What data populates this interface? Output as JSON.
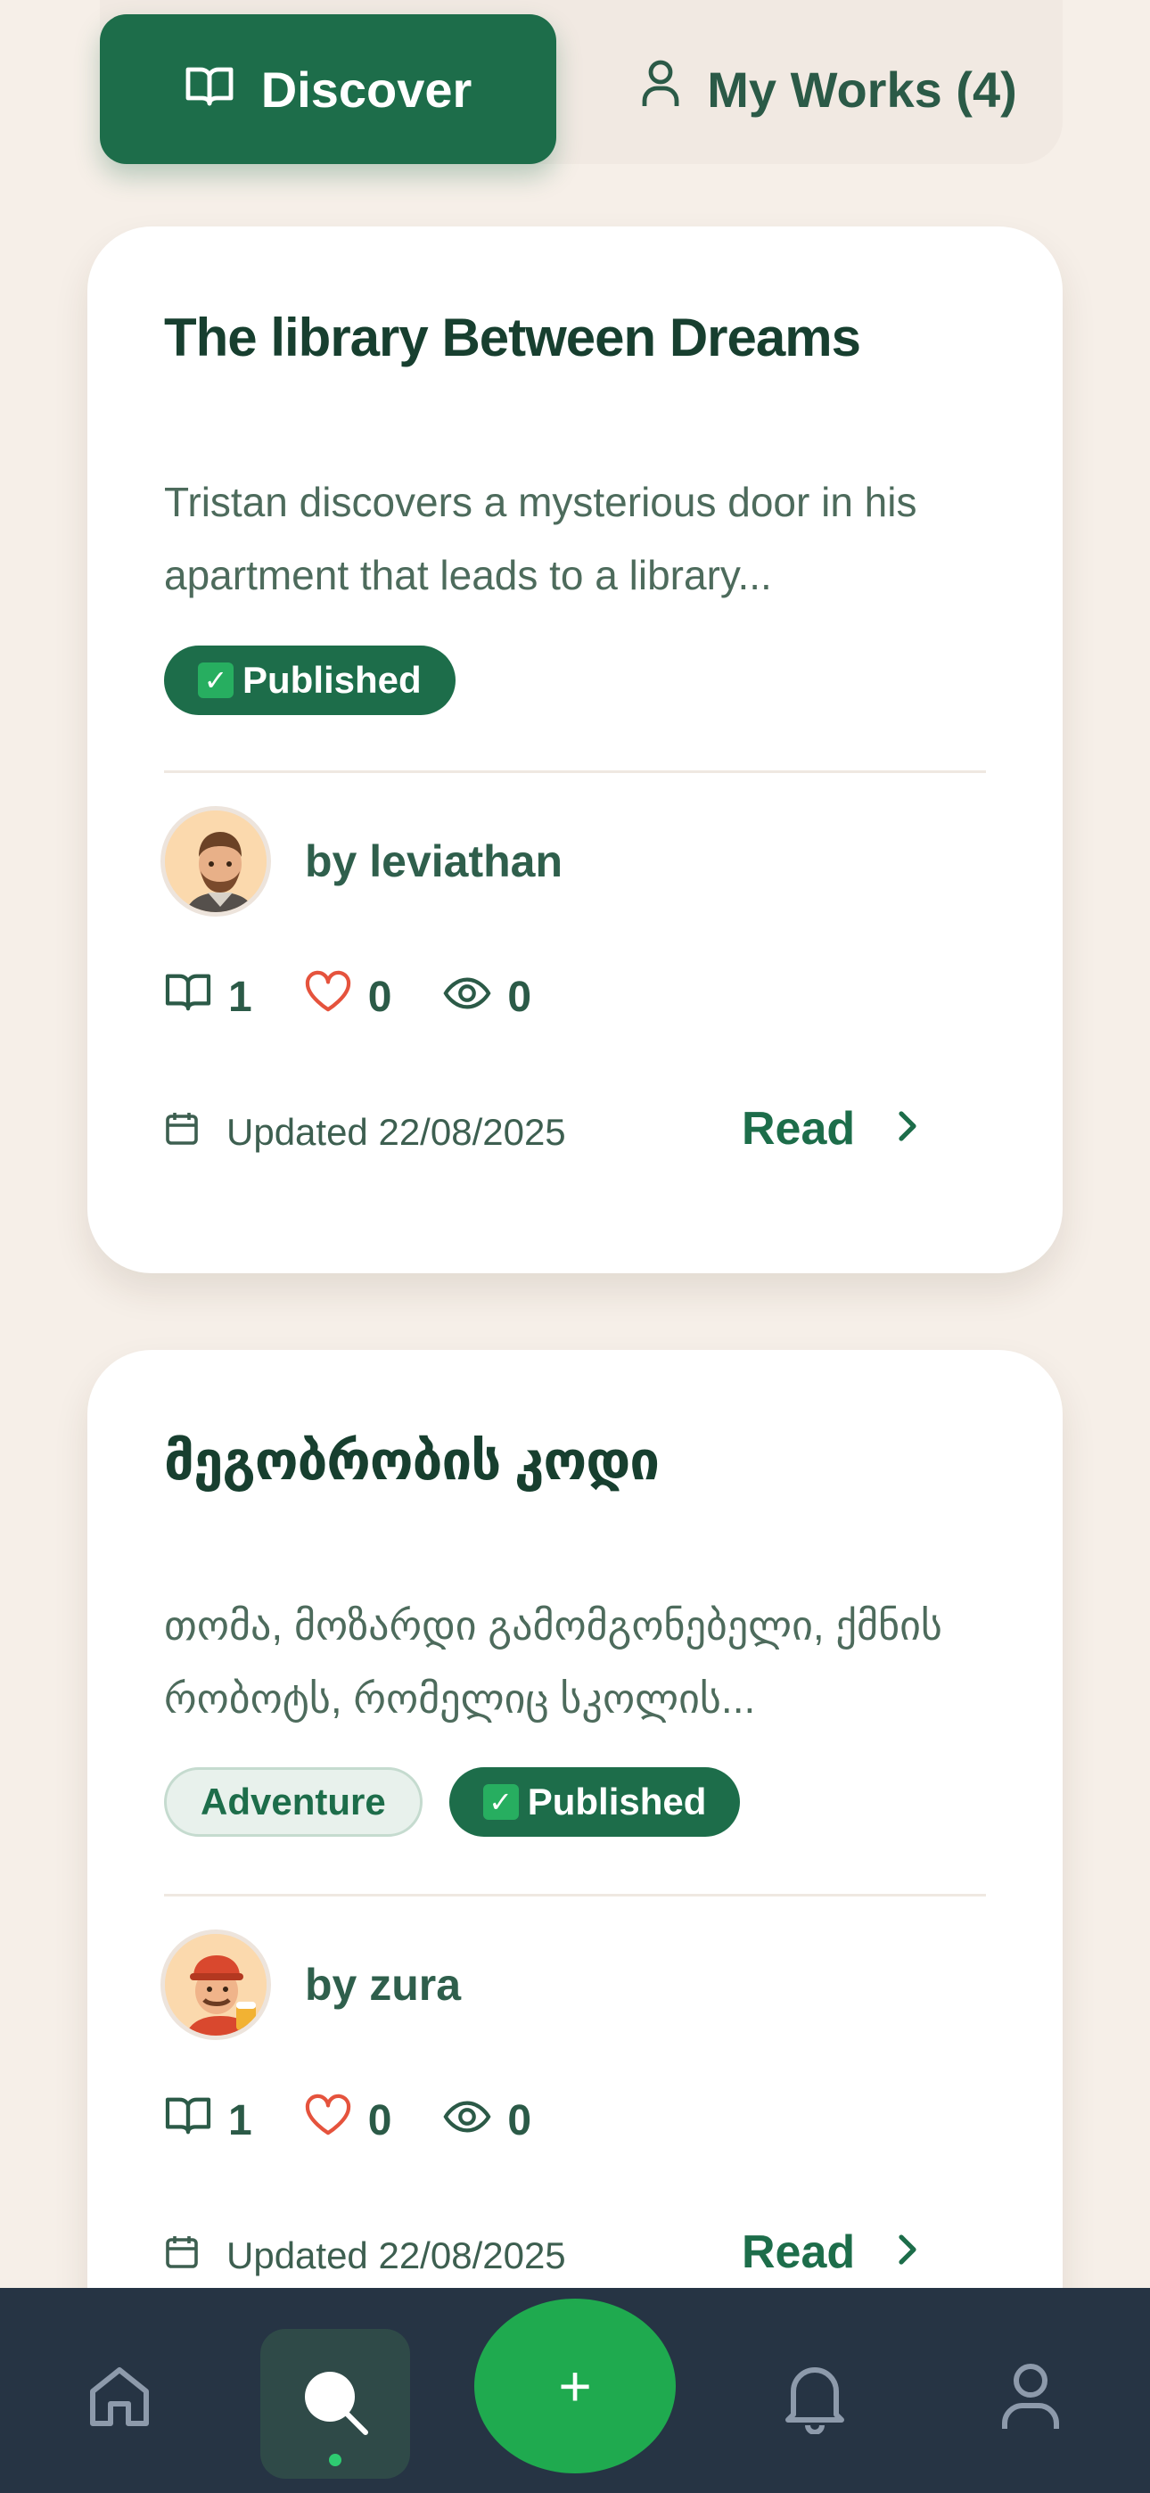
{
  "tabs": {
    "discover_label": "Discover",
    "myworks_label": "My Works (4)"
  },
  "stories": [
    {
      "title": "The library Between Dreams",
      "description": "Tristan discovers a mysterious door in his apartment that leads to a library...",
      "tags": [],
      "status": "Published",
      "author": "by leviathan",
      "chapters": "1",
      "likes": "0",
      "views": "0",
      "updated": "Updated 22/08/2025",
      "read_label": "Read"
    },
    {
      "title": "მეგობრობის კოდი",
      "description": "თომა, მოზარდი გამომგონებელი, ქმნის რობოტს, რომელიც სკოლის...",
      "genre": "Adventure",
      "status": "Published",
      "author": "by zura",
      "chapters": "1",
      "likes": "0",
      "views": "0",
      "updated": "Updated 22/08/2025",
      "read_label": "Read"
    }
  ],
  "nav": {
    "items": [
      "home-icon",
      "search-icon",
      "add-icon",
      "bell-icon",
      "profile-icon"
    ],
    "active": "search-icon",
    "fab_symbol": "+"
  },
  "colors": {
    "primary": "#1d6d4a",
    "background": "#f6efe8",
    "nav_bg": "#263444",
    "fab": "#1faa4f",
    "heart": "#e5533d"
  }
}
